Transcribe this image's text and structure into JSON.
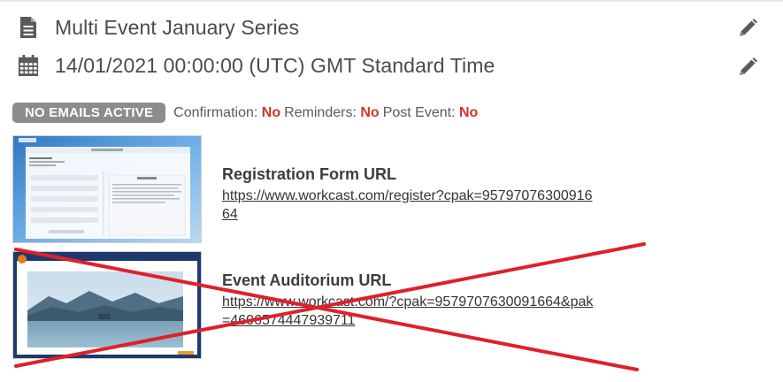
{
  "event": {
    "title": "Multi Event January Series",
    "title_icon": "document-icon",
    "date": "14/01/2021 00:00:00 (UTC) GMT Standard Time",
    "date_icon": "calendar-icon",
    "edit_icon": "pencil-icon"
  },
  "emails": {
    "badge": "NO EMAILS ACTIVE",
    "confirmation_label": "Confirmation:",
    "confirmation_value": "No",
    "reminders_label": "Reminders:",
    "reminders_value": "No",
    "post_event_label": "Post Event:",
    "post_event_value": "No"
  },
  "registration": {
    "title": "Registration Form URL",
    "url": "https://www.workcast.com/register?cpak=9579707630091664"
  },
  "auditorium": {
    "title": "Event Auditorium URL",
    "url": "https://www.workcast.com/?cpak=9579707630091664&pak=4606574447939711",
    "crossed_out": true
  },
  "colors": {
    "accent_no": "#d0342c",
    "badge": "#8c8c8c",
    "icon": "#5a5a5a",
    "cross": "#e0202a"
  }
}
